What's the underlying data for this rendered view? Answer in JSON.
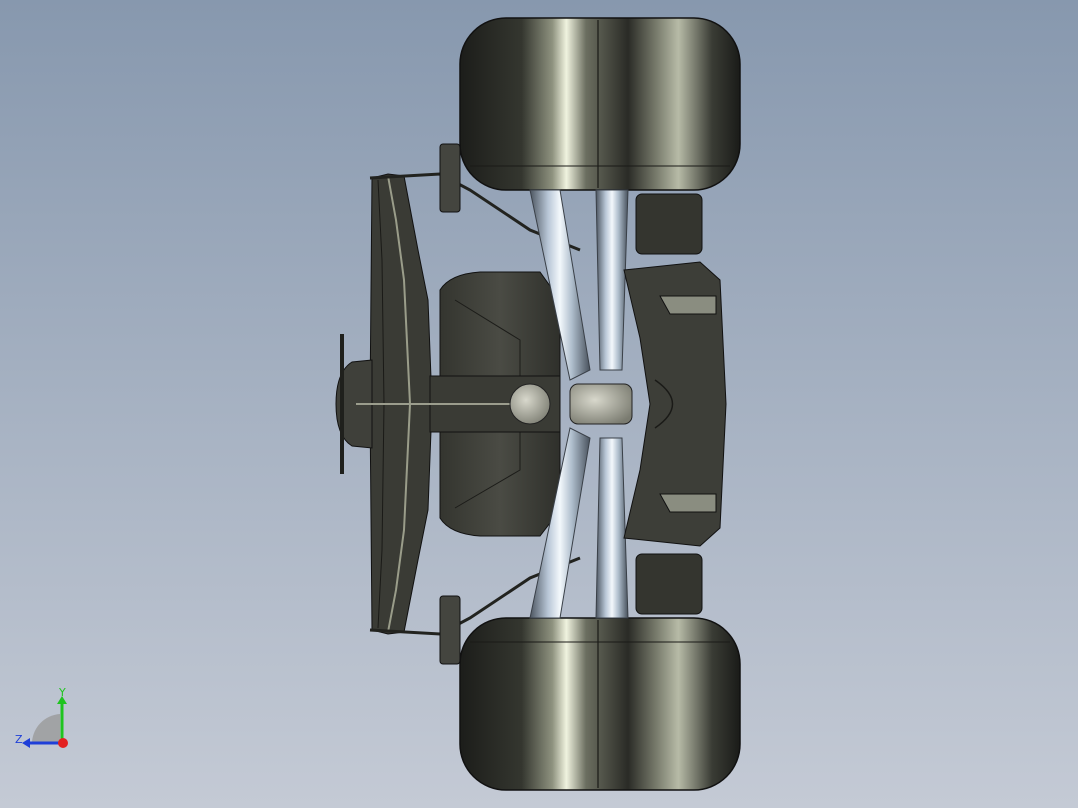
{
  "colors": {
    "background_top": "#8798ae",
    "background_bottom": "#c4cad5",
    "tire": "#2a2b26",
    "body": "#3e3f39",
    "tube_highlight": "#d9e6f2",
    "axis_x": "#e32020",
    "axis_y": "#1fc41f",
    "axis_z": "#1f3fd8"
  },
  "view_triad": {
    "y_label": "Y",
    "z_label": "Z"
  }
}
